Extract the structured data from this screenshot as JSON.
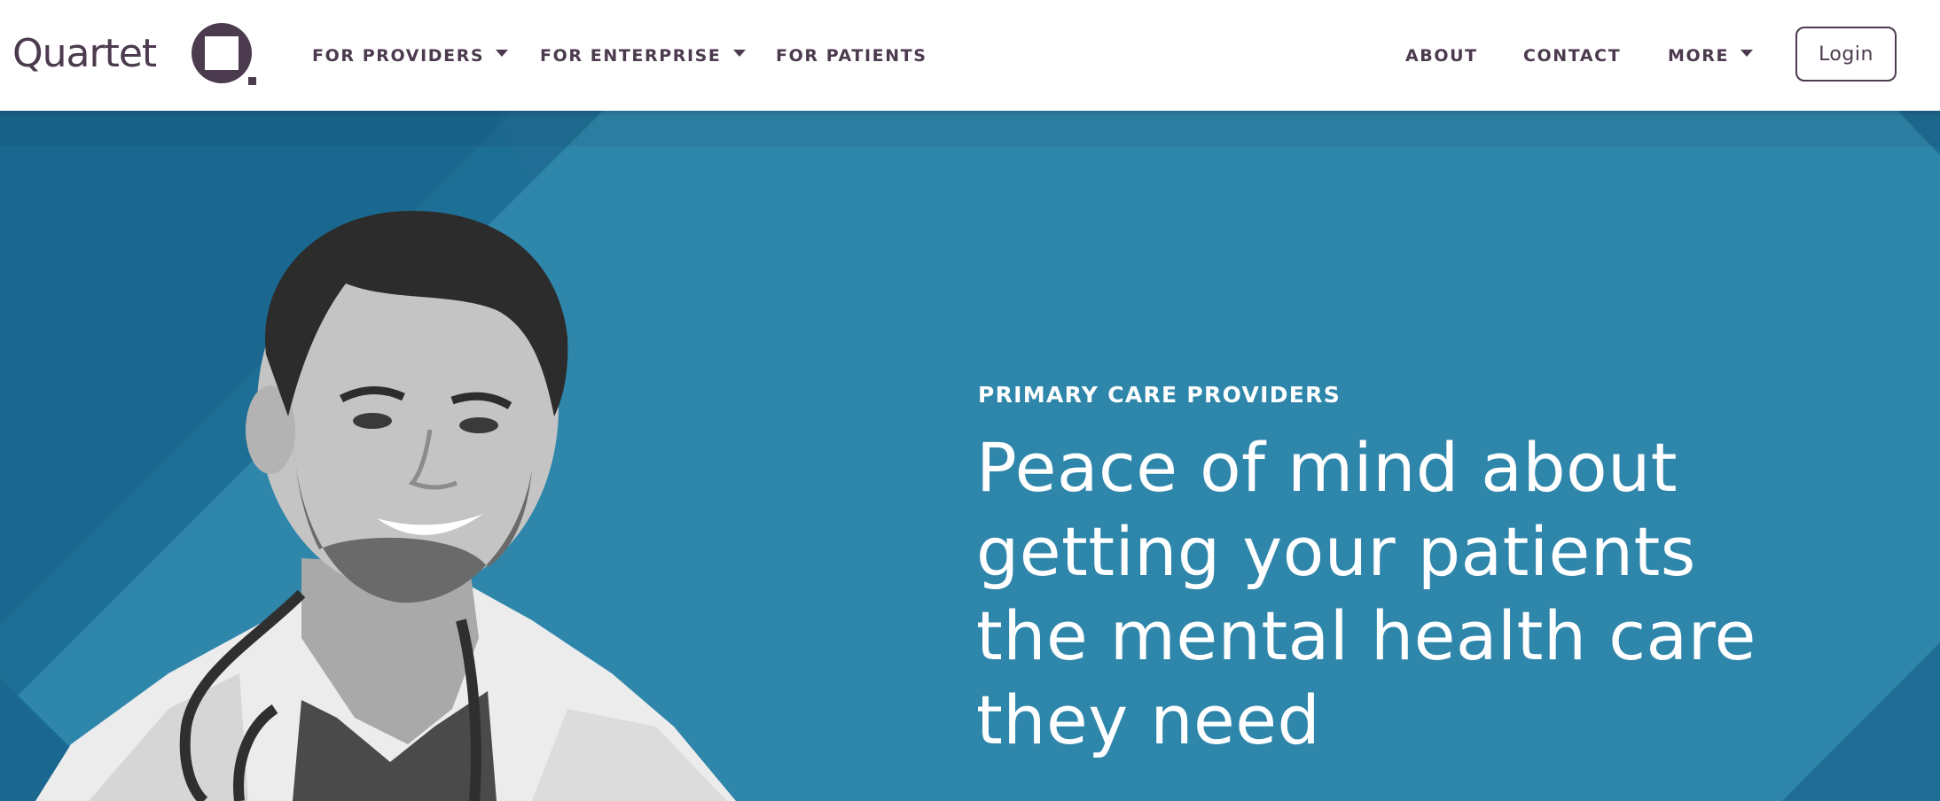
{
  "brand": {
    "name": "Quartet",
    "primary_color": "#4c3a4f",
    "hero_color": "#2f86ab"
  },
  "nav": {
    "left": [
      {
        "label": "FOR PROVIDERS",
        "has_dropdown": true
      },
      {
        "label": "FOR ENTERPRISE",
        "has_dropdown": true
      },
      {
        "label": "FOR PATIENTS",
        "has_dropdown": false
      }
    ],
    "right": [
      {
        "label": "ABOUT",
        "has_dropdown": false
      },
      {
        "label": "CONTACT",
        "has_dropdown": false
      },
      {
        "label": "MORE",
        "has_dropdown": true
      }
    ],
    "login_label": "Login"
  },
  "hero": {
    "eyebrow": "PRIMARY CARE PROVIDERS",
    "headline_lines": [
      "Peace of mind about",
      "getting your patients",
      "the mental health care",
      "they need"
    ],
    "image_icon": "doctor-portrait-image"
  }
}
